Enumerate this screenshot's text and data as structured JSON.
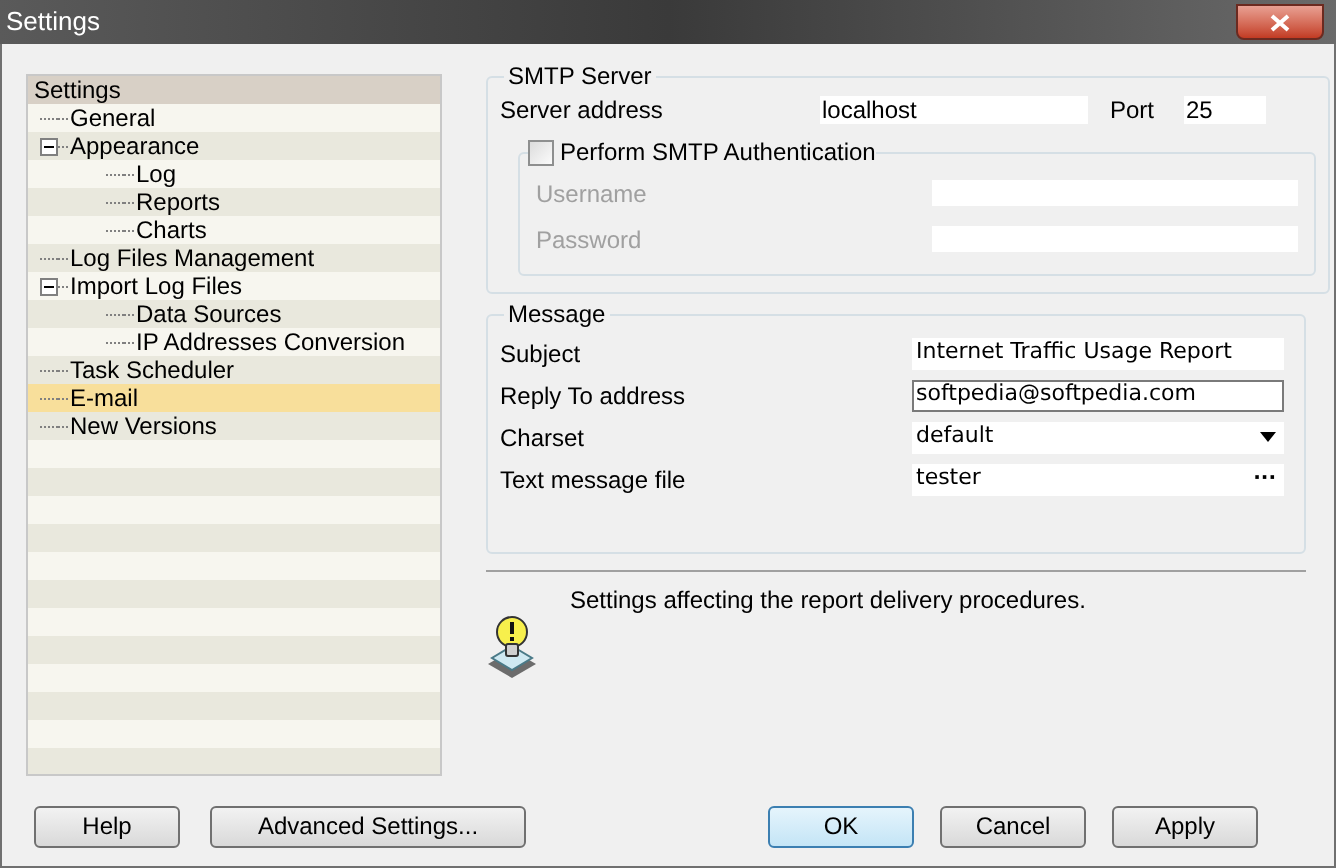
{
  "window": {
    "title": "Settings"
  },
  "tree": {
    "root": "Settings",
    "items": [
      {
        "label": "General",
        "selected": false
      },
      {
        "label": "Appearance",
        "selected": false,
        "expanded": true,
        "children": [
          {
            "label": "Log",
            "selected": false
          },
          {
            "label": "Reports",
            "selected": false
          },
          {
            "label": "Charts",
            "selected": false
          }
        ]
      },
      {
        "label": "Log Files Management",
        "selected": false
      },
      {
        "label": "Import Log Files",
        "selected": false,
        "expanded": true,
        "children": [
          {
            "label": "Data Sources",
            "selected": false
          },
          {
            "label": "IP Addresses Conversion",
            "selected": false
          }
        ]
      },
      {
        "label": "Task Scheduler",
        "selected": false
      },
      {
        "label": "E-mail",
        "selected": true
      },
      {
        "label": "New Versions",
        "selected": false
      }
    ]
  },
  "smtp": {
    "title": "SMTP Server",
    "server_label": "Server address",
    "server_value": "localhost",
    "port_label": "Port",
    "port_value": "25",
    "auth": {
      "label": "Perform SMTP Authentication",
      "checked": false,
      "fields": [
        {
          "label": "Username",
          "disabled": true
        },
        {
          "label": "Password",
          "disabled": true
        }
      ]
    }
  },
  "message": {
    "title": "Message",
    "fields": [
      {
        "kind": "text",
        "label": "Subject",
        "value": "Internet Traffic Usage Report",
        "focused": false
      },
      {
        "kind": "text",
        "label": "Reply To address",
        "value": "softpedia@softpedia.com",
        "focused": true
      },
      {
        "kind": "dropdown",
        "label": "Charset",
        "value": "default",
        "focused": false
      },
      {
        "kind": "browse",
        "label": "Text message file",
        "value": "tester",
        "focused": false,
        "button": "···"
      }
    ]
  },
  "info": "Settings affecting the report delivery procedures.",
  "buttons_left": [
    "Help",
    "Advanced Settings..."
  ],
  "buttons_right": [
    {
      "label": "OK",
      "default": true
    },
    {
      "label": "Cancel",
      "default": false
    },
    {
      "label": "Apply",
      "default": false
    }
  ]
}
